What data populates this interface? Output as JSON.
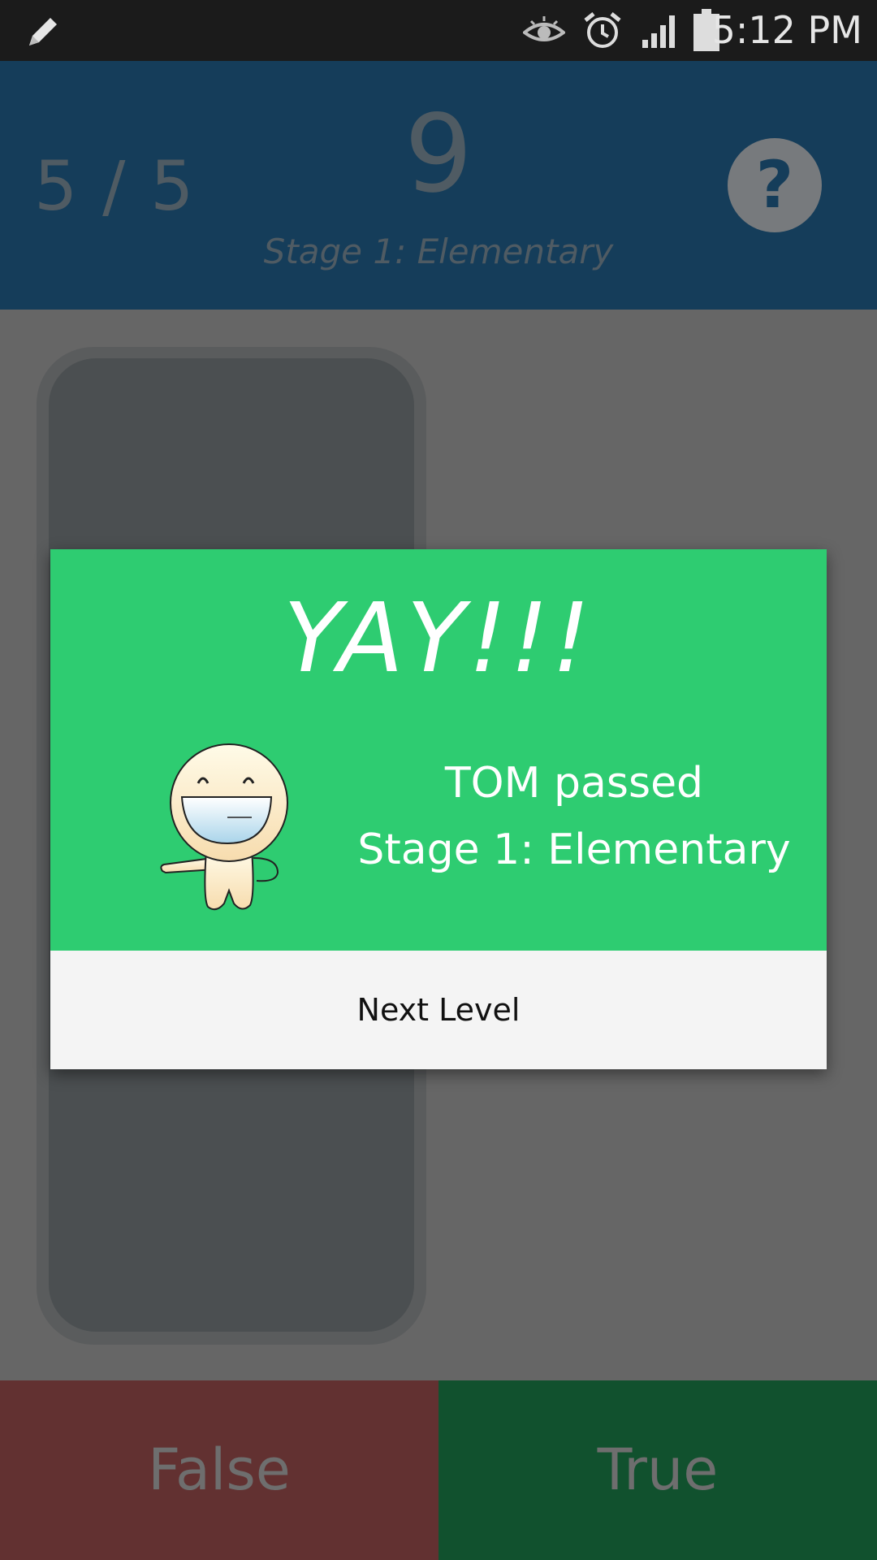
{
  "status_bar": {
    "time": "5:12 PM",
    "icons": [
      "pencil-icon",
      "eye-icon",
      "alarm-icon",
      "signal-icon",
      "battery-icon"
    ]
  },
  "header": {
    "score": "5 / 5",
    "number": "9",
    "stage": "Stage 1: Elementary",
    "help_label": "?"
  },
  "dialog": {
    "title": "YAY!!!",
    "message_line1": "TOM passed",
    "message_line2": "Stage 1: Elementary",
    "button_label": "Next Level"
  },
  "answers": {
    "false_label": "False",
    "true_label": "True"
  },
  "colors": {
    "header_bg": "#153d5a",
    "dialog_green": "#2ecc71",
    "false_bg": "#623131",
    "true_bg": "#11512e"
  }
}
